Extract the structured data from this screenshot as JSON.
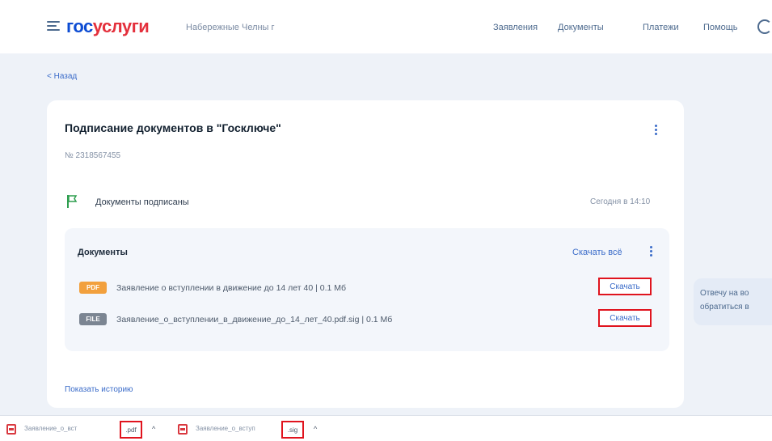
{
  "header": {
    "logo_part1": "гос",
    "logo_part2": "услуги",
    "city": "Набережные Челны г",
    "nav": [
      "Заявления",
      "Документы",
      "Платежи",
      "Помощь"
    ]
  },
  "back_label": "< Назад",
  "card": {
    "title": "Подписание документов в \"Госключе\"",
    "number": "№ 2318567455",
    "status_text": "Документы подписаны",
    "status_time": "Сегодня в 14:10",
    "docs": {
      "title": "Документы",
      "download_all": "Скачать всё",
      "items": [
        {
          "badge": "PDF",
          "name": "Заявление о вступлении в движение до 14 лет 40 | 0.1 Мб",
          "action": "Скачать"
        },
        {
          "badge": "FILE",
          "name": "Заявление_о_вступлении_в_движение_до_14_лет_40.pdf.sig | 0.1 Мб",
          "action": "Скачать"
        }
      ]
    },
    "show_history": "Показать историю"
  },
  "tip": {
    "line1": "Отвечу на во",
    "line2": "обратиться в"
  },
  "downloads_bar": {
    "items": [
      {
        "name": "Заявление_о_вст",
        "ext": ".pdf"
      },
      {
        "name": "Заявление_о_вступ",
        "ext": ".sig"
      }
    ]
  },
  "colors": {
    "brand_blue": "#0d4cd3",
    "brand_red": "#e4303c",
    "highlight": "#e0141e",
    "pdf_badge": "#f2a03d"
  }
}
